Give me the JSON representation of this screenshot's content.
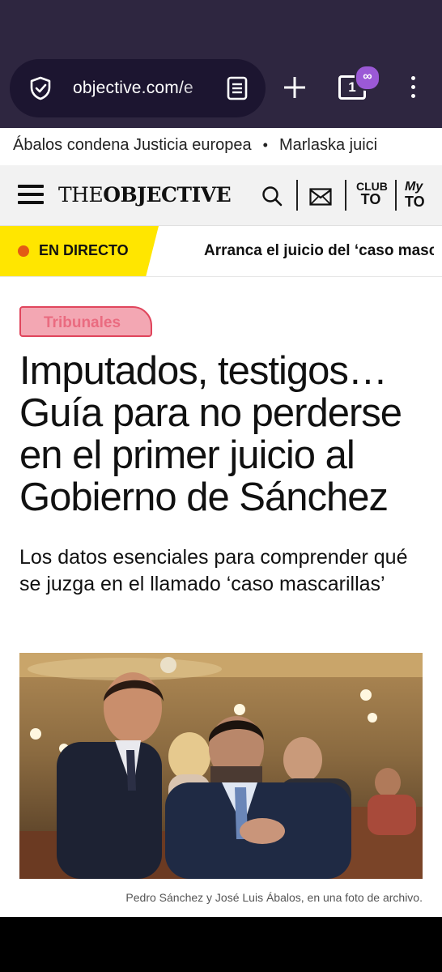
{
  "browser": {
    "url_text": "objective.com/e",
    "tab_count": "1",
    "private_badge": "∞",
    "icons": [
      "shield-icon",
      "reader-mode-icon",
      "new-tab-plus-icon",
      "tabs-icon",
      "more-menu-icon"
    ]
  },
  "ticker": {
    "items": [
      "Ábalos condena Justicia europea",
      "Marlaska juici"
    ],
    "separator": "•"
  },
  "site_header": {
    "logo_prefix": "THE",
    "logo_bold": "OBJECTIVE",
    "club_line1": "CLUB",
    "club_line2": "TO",
    "my_line1": "My",
    "my_line2": "TO"
  },
  "live": {
    "label": "EN DIRECTO",
    "headline": "Arranca el juicio del ‘caso mascarillas’",
    "accent_color": "#ffe600",
    "dot_color": "#e35b14"
  },
  "article": {
    "section_tag": "Tribunales",
    "headline": "Imputados, testigos… Guía para no perderse en el primer juicio al Gobierno de Sánchez",
    "subheadline": "Los datos esenciales para comprender qué se juzga en el llamado ‘caso mascarillas’",
    "image_caption": "Pedro Sánchez y José Luis Ábalos, en una foto de archivo."
  }
}
